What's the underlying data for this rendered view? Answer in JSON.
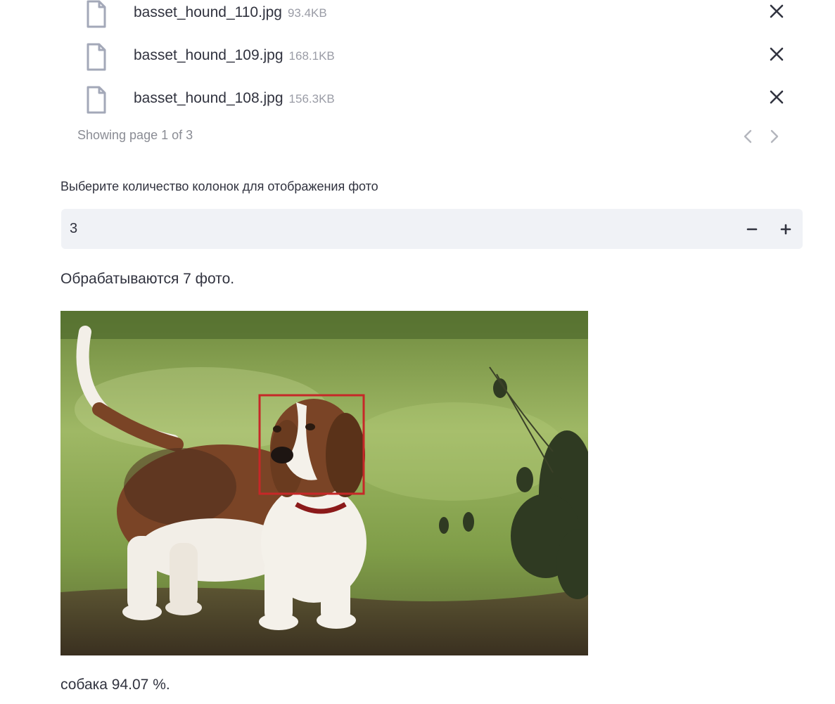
{
  "files": [
    {
      "name": "basset_hound_110.jpg",
      "size": "93.4KB"
    },
    {
      "name": "basset_hound_109.jpg",
      "size": "168.1KB"
    },
    {
      "name": "basset_hound_108.jpg",
      "size": "156.3KB"
    }
  ],
  "pagination": {
    "text": "Showing page 1 of 3",
    "prev_icon": "chevron-left-icon",
    "next_icon": "chevron-right-icon"
  },
  "columns_input": {
    "label": "Выберите количество колонок для отображения фото",
    "value": "3",
    "decrement_icon": "minus-icon",
    "increment_icon": "plus-icon"
  },
  "status": "Обрабатываются 7 фото.",
  "result": {
    "caption": "собака 94.07 %.",
    "box_color": "#c62828"
  },
  "colors": {
    "text": "#31333f",
    "muted": "#9a9ca6",
    "input_bg": "#f0f2f6",
    "file_icon": "#a3a8b8"
  }
}
